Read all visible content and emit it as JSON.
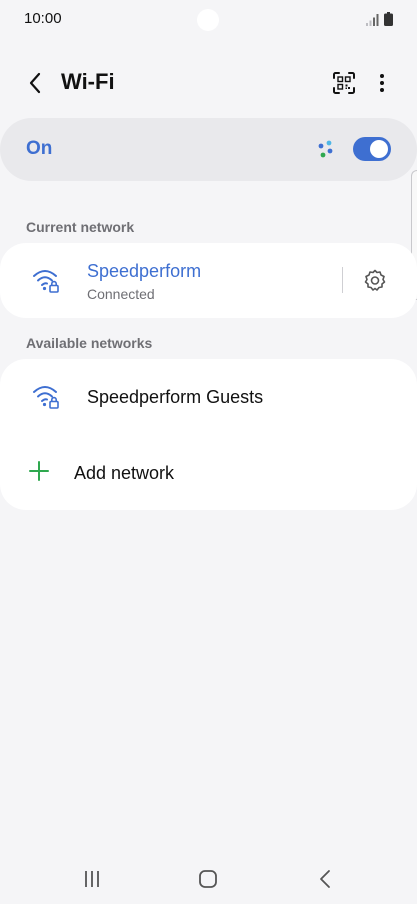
{
  "status_bar": {
    "time": "10:00"
  },
  "header": {
    "title": "Wi-Fi"
  },
  "wifi_toggle": {
    "label": "On",
    "enabled": true,
    "accent_color": "#3e6fd1"
  },
  "current_network": {
    "section_label": "Current network",
    "name": "Speedperform",
    "status": "Connected"
  },
  "available_networks": {
    "section_label": "Available networks",
    "items": [
      {
        "name": "Speedperform Guests"
      }
    ],
    "add_label": "Add network",
    "add_icon_color": "#2fa84f"
  },
  "icons": {
    "back": "chevron-left-icon",
    "qr": "qr-code-scan-icon",
    "more": "more-vertical-icon",
    "dots": "dots-cluster-icon",
    "wifi": "wifi-lock-icon",
    "settings": "gear-icon",
    "add": "plus-icon"
  }
}
